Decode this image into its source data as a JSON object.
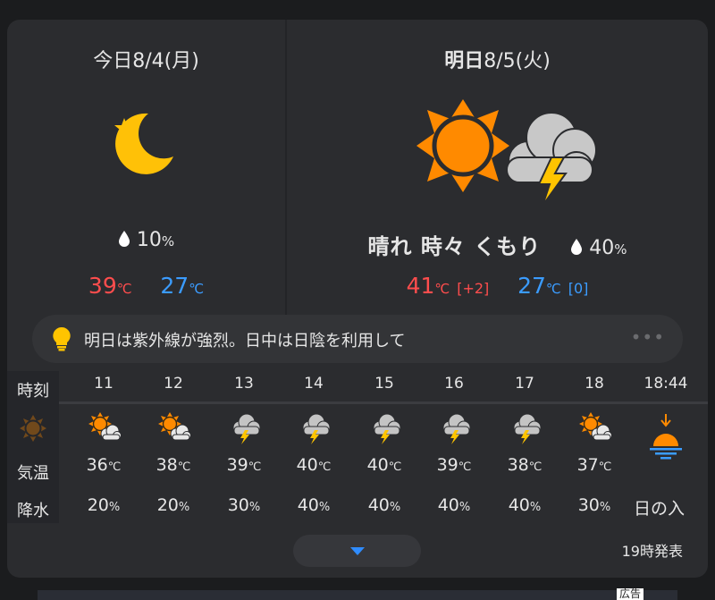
{
  "today": {
    "date": "今日8/4(月)",
    "icon": "moon-star-icon",
    "precip": "10",
    "precip_unit": "%",
    "high": "39",
    "low": "27",
    "unit": "℃"
  },
  "tomorrow": {
    "date_bold": "明日",
    "date_rest": "8/5(火)",
    "icon": "sun-then-thunder-icon",
    "condition": "晴れ 時々 くもり",
    "precip": "40",
    "precip_unit": "%",
    "high": "41",
    "high_diff": "[+2]",
    "low": "27",
    "low_diff": "[0]",
    "unit": "℃"
  },
  "tip": {
    "text": "明日は紫外線が強烈。日中は日陰を利用して",
    "icon": "lightbulb-icon",
    "more": "•••"
  },
  "hourly": {
    "labels": {
      "time": "時刻",
      "temp": "気温",
      "precip": "降水"
    },
    "hours": [
      {
        "hour": "11",
        "icon": "sun-cloud-icon",
        "temp": "36",
        "precip": "20"
      },
      {
        "hour": "12",
        "icon": "sun-cloud-icon",
        "temp": "38",
        "precip": "20"
      },
      {
        "hour": "13",
        "icon": "thunder-cloud-icon",
        "temp": "39",
        "precip": "30"
      },
      {
        "hour": "14",
        "icon": "thunder-cloud-icon",
        "temp": "40",
        "precip": "40"
      },
      {
        "hour": "15",
        "icon": "thunder-cloud-icon",
        "temp": "40",
        "precip": "40"
      },
      {
        "hour": "16",
        "icon": "thunder-cloud-icon",
        "temp": "39",
        "precip": "40"
      },
      {
        "hour": "17",
        "icon": "thunder-cloud-icon",
        "temp": "38",
        "precip": "40"
      },
      {
        "hour": "18",
        "icon": "sun-cloud-icon",
        "temp": "37",
        "precip": "30"
      }
    ],
    "sunset": {
      "time": "18:44",
      "icon": "sunset-icon",
      "label": "日の入"
    },
    "temp_unit": "℃",
    "precip_unit": "%"
  },
  "footer": {
    "issued": "19時発表",
    "expand_icon": "chevron-down-icon"
  },
  "ad": {
    "label": "広告"
  },
  "colors": {
    "high": "#ff4d4d",
    "low": "#3b9cff",
    "sun": "#ff8a00",
    "moon": "#ffc107",
    "cloud": "#b4b4b4",
    "bolt": "#ffc400",
    "accent": "#2f8cff"
  }
}
